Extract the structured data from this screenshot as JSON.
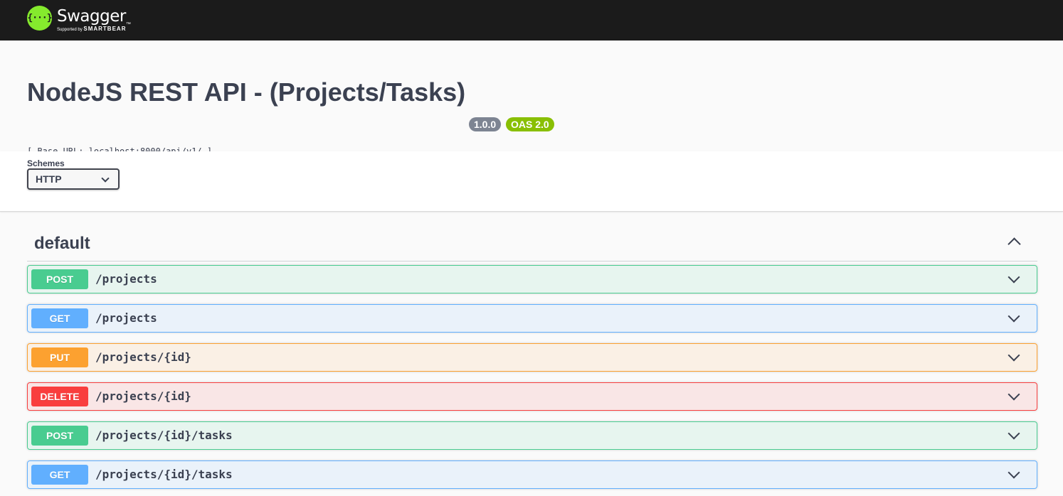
{
  "topbar": {
    "logo_icon": "{···}",
    "logo_name": "Swagger",
    "logo_tm": "™",
    "logo_sub_prefix": "Supported by ",
    "logo_sub_brand": "SMARTBEAR"
  },
  "info": {
    "title": "NodeJS REST API - (Projects/Tasks)",
    "version": "1.0.0",
    "oas": "OAS 2.0",
    "base_url": "[ Base URL: localhost:8000/api/v1/ ]"
  },
  "schemes": {
    "label": "Schemes",
    "selected": "HTTP"
  },
  "tag": {
    "name": "default"
  },
  "operations": [
    {
      "method": "POST",
      "path": "/projects"
    },
    {
      "method": "GET",
      "path": "/projects"
    },
    {
      "method": "PUT",
      "path": "/projects/{id}"
    },
    {
      "method": "DELETE",
      "path": "/projects/{id}"
    },
    {
      "method": "POST",
      "path": "/projects/{id}/tasks"
    },
    {
      "method": "GET",
      "path": "/projects/{id}/tasks"
    }
  ],
  "colors": {
    "post": "#49cc90",
    "get": "#61affe",
    "put": "#fca130",
    "delete": "#f93e3e",
    "topbar": "#1b1b1b",
    "logo": "#85ea2d"
  }
}
